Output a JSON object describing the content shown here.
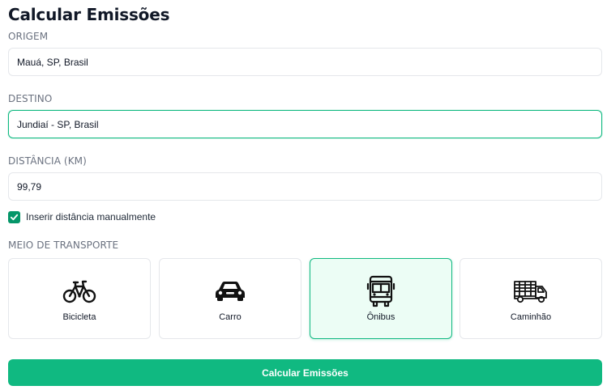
{
  "form": {
    "title": "Calcular Emissões",
    "origin": {
      "label": "ORIGEM",
      "value": "Mauá, SP, Brasil"
    },
    "destination": {
      "label": "DESTINO",
      "value": "Jundiaí - SP, Brasil"
    },
    "distance": {
      "label": "DISTÂNCIA (KM)",
      "value": "99,79"
    },
    "manual_distance": {
      "label": "Inserir distância manualmente",
      "checked": true
    },
    "transport": {
      "label": "MEIO DE TRANSPORTE",
      "options": [
        {
          "label": "Bicicleta",
          "icon": "bicycle-icon",
          "selected": false
        },
        {
          "label": "Carro",
          "icon": "car-icon",
          "selected": false
        },
        {
          "label": "Ônibus",
          "icon": "bus-icon",
          "selected": true
        },
        {
          "label": "Caminhão",
          "icon": "truck-icon",
          "selected": false
        }
      ]
    },
    "submit_label": "Calcular Emissões"
  },
  "colors": {
    "accent": "#10b981",
    "checkbox": "#059669",
    "selected_bg": "#ecfdf5",
    "border": "#e5e7eb",
    "label": "#6b7280"
  }
}
